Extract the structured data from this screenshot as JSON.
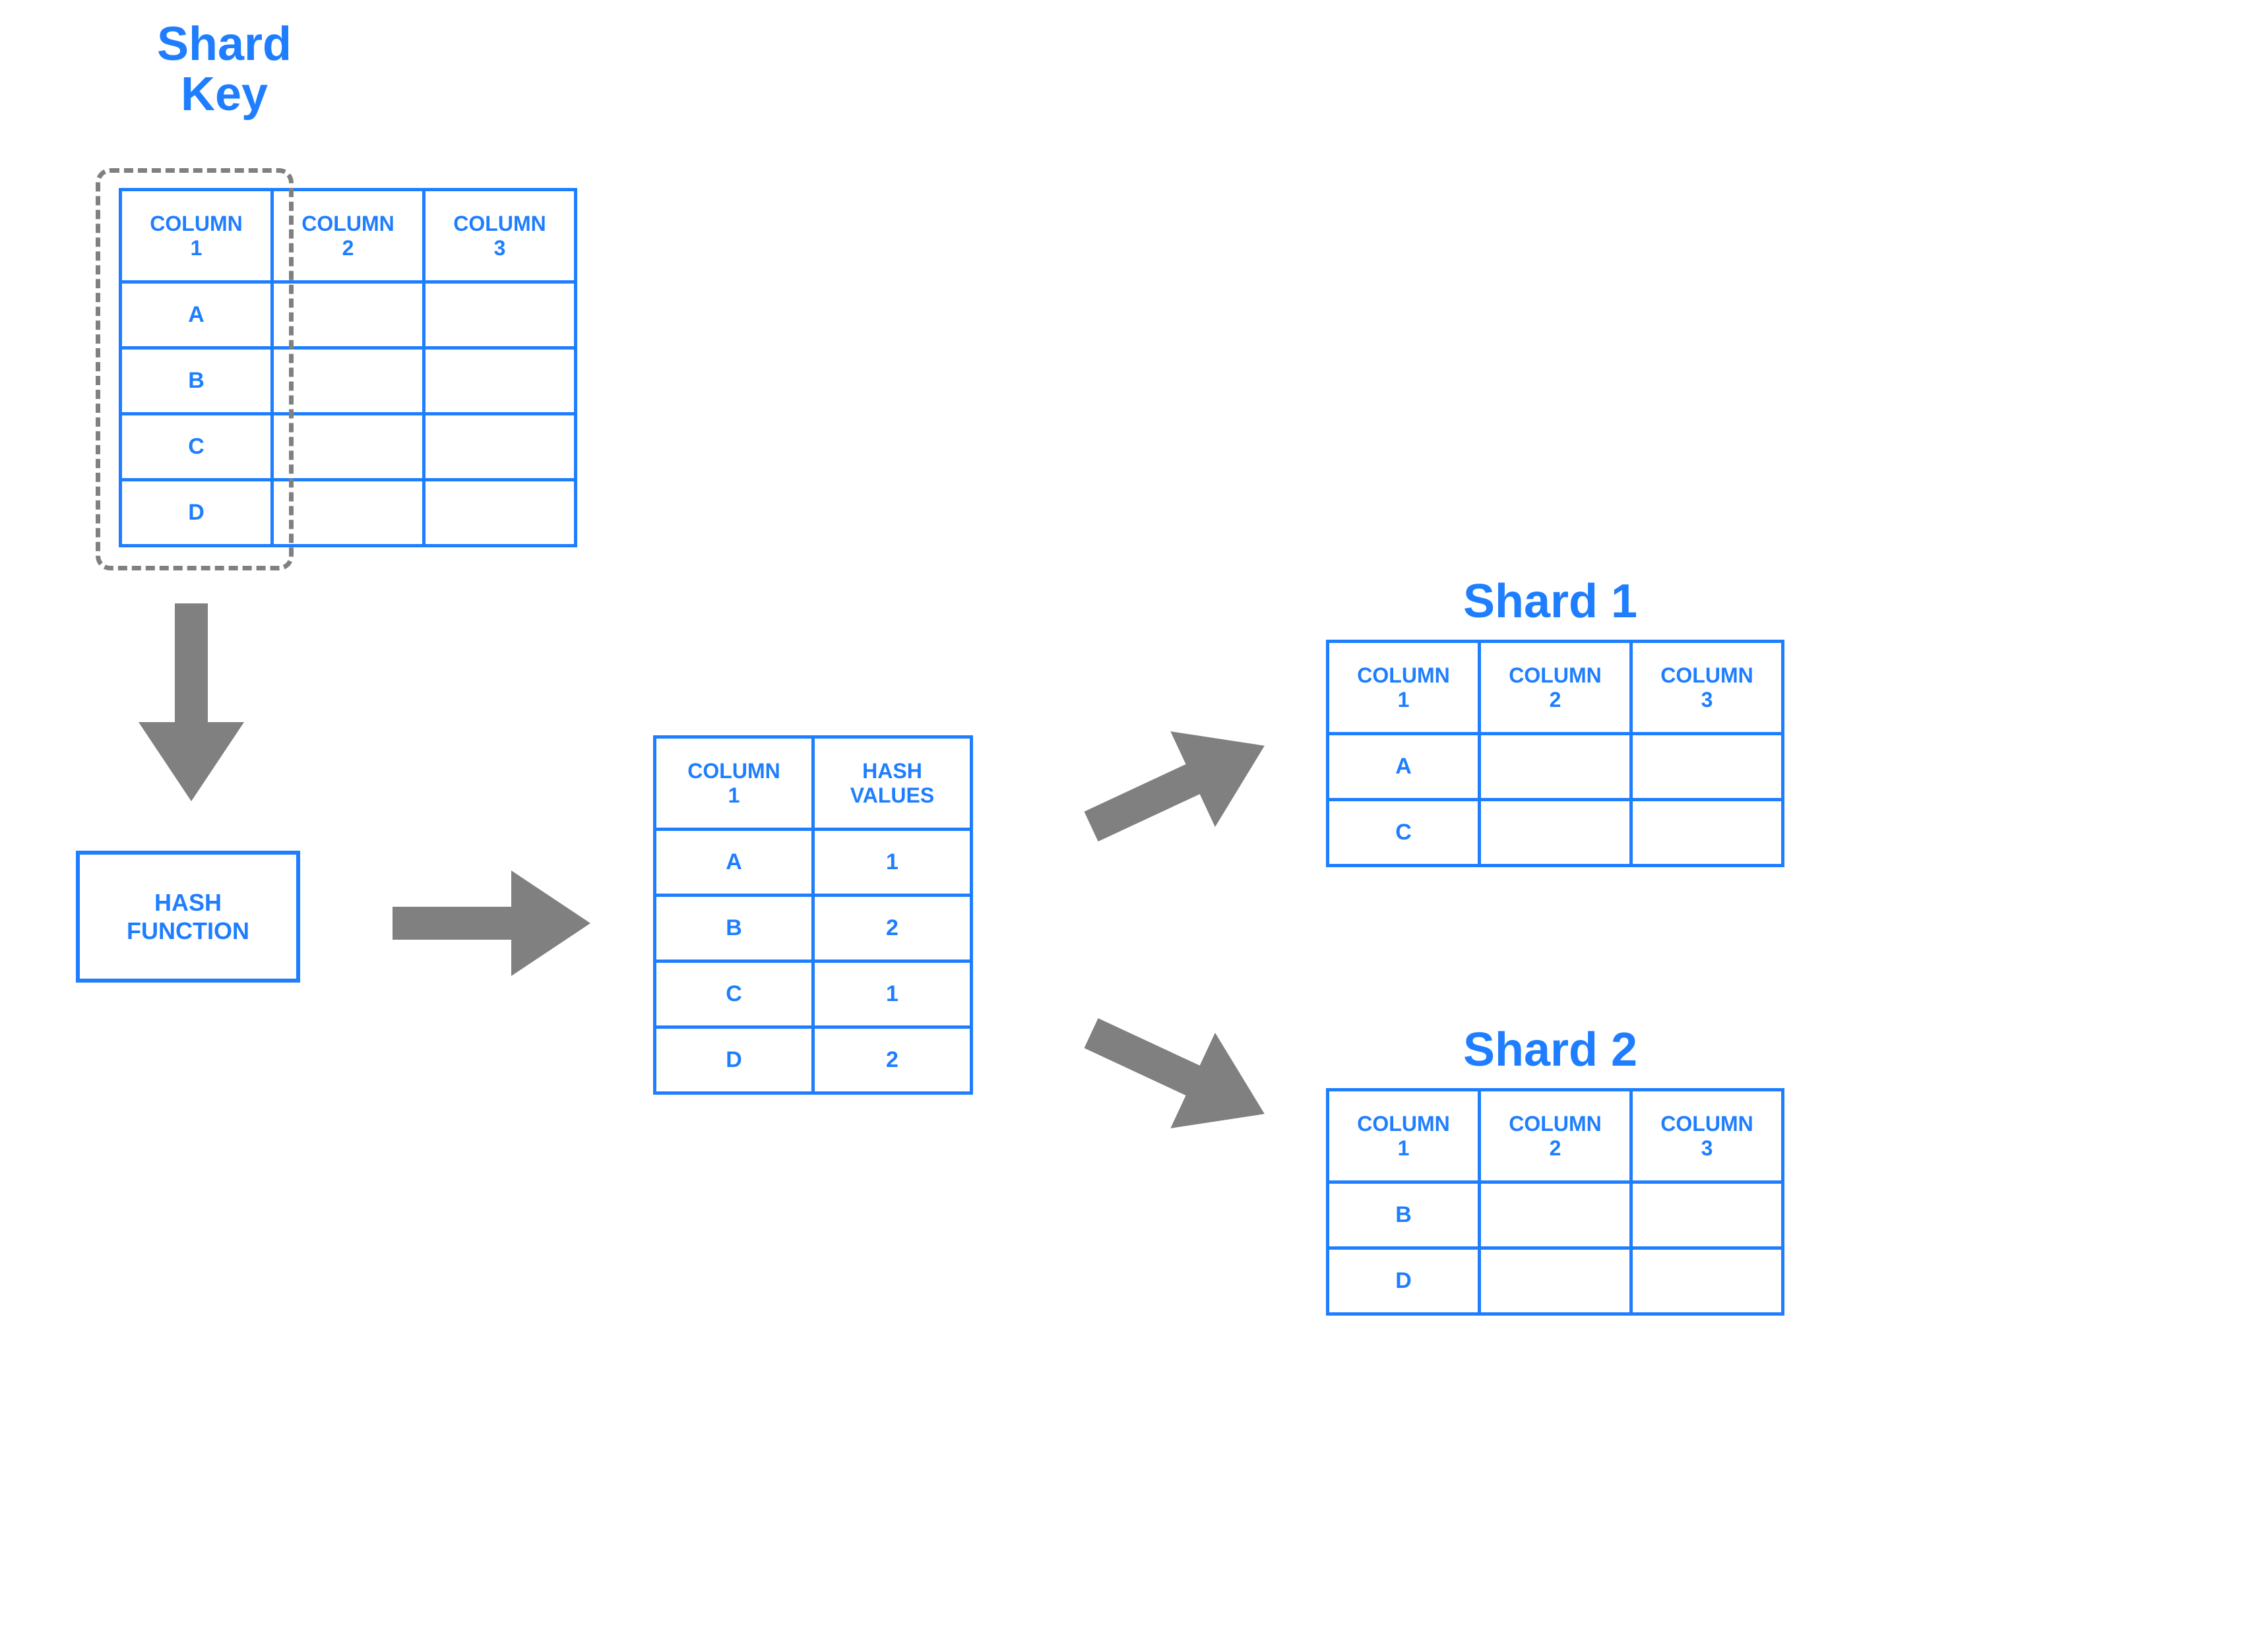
{
  "labels": {
    "shard_key_title": "Shard\nKey",
    "hash_function": "HASH\nFUNCTION",
    "shard1_title": "Shard 1",
    "shard2_title": "Shard 2",
    "col1": "COLUMN\n1",
    "col2": "COLUMN\n2",
    "col3": "COLUMN\n3",
    "hash_values_header": "HASH\nVALUES"
  },
  "source_table": {
    "rows": [
      "A",
      "B",
      "C",
      "D"
    ]
  },
  "hash_table": {
    "rows": [
      {
        "key": "A",
        "hash": "1"
      },
      {
        "key": "B",
        "hash": "2"
      },
      {
        "key": "C",
        "hash": "1"
      },
      {
        "key": "D",
        "hash": "2"
      }
    ]
  },
  "shard1": {
    "rows": [
      "A",
      "C"
    ]
  },
  "shard2": {
    "rows": [
      "B",
      "D"
    ]
  }
}
